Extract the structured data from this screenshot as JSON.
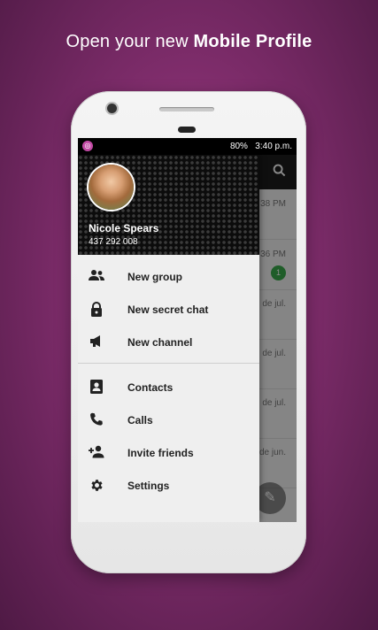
{
  "headline": {
    "prefix": "Open your new",
    "bold": "Mobile Profile"
  },
  "statusbar": {
    "battery": "80%",
    "time": "3:40 p.m."
  },
  "chat_list": {
    "rows": [
      {
        "time": "38 PM"
      },
      {
        "time": "36 PM",
        "badge": "1"
      },
      {
        "time": "de jul."
      },
      {
        "time": "de jul."
      },
      {
        "time": "de jul."
      },
      {
        "time": "de jun."
      }
    ]
  },
  "profile": {
    "name": "Nicole Spears",
    "phone": "437 292 008"
  },
  "menu": {
    "new_group": "New group",
    "new_secret_chat": "New secret chat",
    "new_channel": "New channel",
    "contacts": "Contacts",
    "calls": "Calls",
    "invite_friends": "Invite friends",
    "settings": "Settings"
  },
  "colors": {
    "background": "#8e3478",
    "drawer_bg": "#efefef",
    "badge": "#3aa94b"
  },
  "icons": [
    "group-icon",
    "lock-icon",
    "megaphone-icon",
    "contacts-icon",
    "phone-icon",
    "add-person-icon",
    "gear-icon",
    "search-icon",
    "pencil-icon"
  ]
}
